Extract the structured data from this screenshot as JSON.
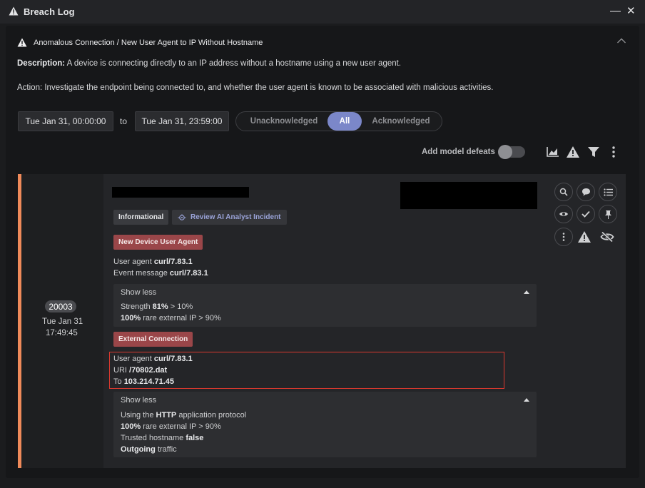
{
  "window": {
    "title": "Breach Log",
    "minimize_glyph": "—",
    "close_glyph": "✕"
  },
  "alert": {
    "title": "Anomalous Connection / New User Agent to IP Without Hostname",
    "description_label": "Description:",
    "description_text": "A device is connecting directly to an IP address without a hostname using a new user agent.",
    "action_text": "Action: Investigate the endpoint being connected to, and whether the user agent is known to be associated with malicious activities."
  },
  "filters": {
    "from_date": "Tue Jan 31, 00:00:00",
    "to_label": "to",
    "to_date": "Tue Jan 31, 23:59:00",
    "segments": [
      "Unacknowledged",
      "All",
      "Acknowledged"
    ],
    "active_segment": "All"
  },
  "toolbar": {
    "add_model_defeats_label": "Add model defeats",
    "toggle_on": false,
    "icons": [
      "chart-icon",
      "warning-icon",
      "filter-icon",
      "more-vertical-icon"
    ]
  },
  "breach": {
    "count": "20003",
    "date": "Tue Jan 31",
    "time": "17:49:45",
    "accent_color": "#ef8a5a",
    "tags": {
      "severity": "Informational",
      "ai_analyst": "Review AI Analyst Incident"
    },
    "component1": {
      "label": "New Device User Agent",
      "user_agent_label": "User agent",
      "user_agent_value": "curl/7.83.1",
      "event_message_label": "Event message",
      "event_message_value": "curl/7.83.1",
      "show_less": "Show less",
      "strength_label": "Strength",
      "strength_value": "81%",
      "strength_suffix": "> 10%",
      "rare_value": "100%",
      "rare_suffix": "rare external IP > 90%"
    },
    "component2": {
      "label": "External Connection",
      "user_agent_label": "User agent",
      "user_agent_value": "curl/7.83.1",
      "uri_label": "URI",
      "uri_value": "/70802.dat",
      "to_label": "To",
      "to_value": "103.214.71.45",
      "show_less": "Show less",
      "protocol_prefix": "Using the",
      "protocol_value": "HTTP",
      "protocol_suffix": "application protocol",
      "rare_value": "100%",
      "rare_suffix": "rare external IP > 90%",
      "hostname_label": "Trusted hostname",
      "hostname_value": "false",
      "outgoing_value": "Outgoing",
      "outgoing_suffix": "traffic"
    },
    "actions": [
      "search-icon",
      "comment-icon",
      "list-icon",
      "eye-icon",
      "check-icon",
      "pin-icon",
      "more-vertical-icon",
      "warning-icon",
      "eye-slash-icon"
    ]
  },
  "colors": {
    "accent_purple": "#7b87c9",
    "tag_red": "#9a4649",
    "highlight_red": "#d9392e"
  }
}
